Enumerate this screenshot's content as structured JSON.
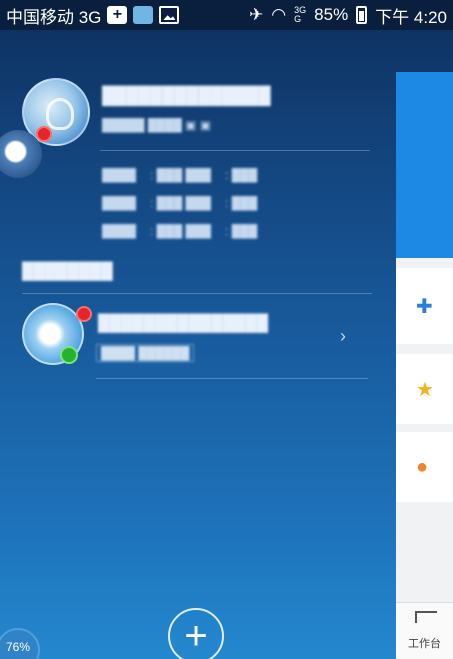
{
  "status_bar": {
    "carrier": "中国移动 3G",
    "battery": "85%",
    "time": "下午 4:20",
    "signal_label_top": "3G",
    "signal_label_bottom": "G"
  },
  "side_panel": {
    "items": [
      {
        "icon": "puzzle-icon"
      },
      {
        "icon": "star-icon"
      },
      {
        "icon": "person-icon"
      }
    ],
    "home_label": "工作台"
  },
  "float_badge": {
    "percent": "76%"
  },
  "colors": {
    "accent": "#1e88e5",
    "badge_red": "#e5252a",
    "badge_green": "#24b22f"
  }
}
